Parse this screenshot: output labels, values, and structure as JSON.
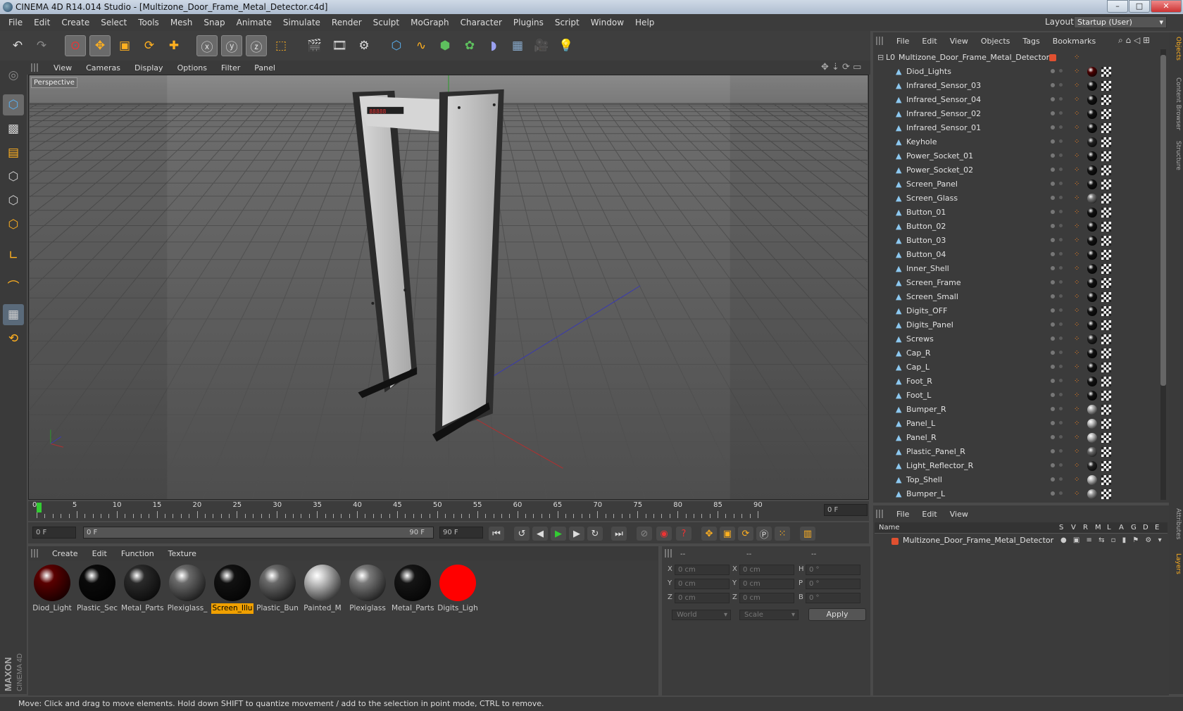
{
  "window": {
    "title": "CINEMA 4D R14.014 Studio - [Multizone_Door_Frame_Metal_Detector.c4d]",
    "minimize": "–",
    "maximize": "□",
    "close": "✕"
  },
  "menu": [
    "File",
    "Edit",
    "Create",
    "Select",
    "Tools",
    "Mesh",
    "Snap",
    "Animate",
    "Simulate",
    "Render",
    "Sculpt",
    "MoGraph",
    "Character",
    "Plugins",
    "Script",
    "Window",
    "Help"
  ],
  "layout": {
    "label": "Layout:",
    "value": "Startup (User)"
  },
  "viewport": {
    "menu": [
      "View",
      "Cameras",
      "Display",
      "Options",
      "Filter",
      "Panel"
    ],
    "label": "Perspective"
  },
  "timeline": {
    "ticks": [
      "0",
      "5",
      "10",
      "15",
      "20",
      "25",
      "30",
      "35",
      "40",
      "45",
      "50",
      "55",
      "60",
      "65",
      "70",
      "75",
      "80",
      "85",
      "90"
    ],
    "frame_field": "0 F",
    "current": "0 F",
    "slider_start": "0 F",
    "slider_end": "90 F",
    "end": "90 F"
  },
  "materials": {
    "menu": [
      "Create",
      "Edit",
      "Function",
      "Texture"
    ],
    "items": [
      {
        "label": "Diod_Light",
        "color": "#5a0000"
      },
      {
        "label": "Plastic_Sec",
        "color": "#0a0a0a"
      },
      {
        "label": "Metal_Parts",
        "color": "#2a2a2a"
      },
      {
        "label": "Plexiglass_",
        "color": "#6a6a6a"
      },
      {
        "label": "Screen_Illu",
        "color": "#111111",
        "selected": true
      },
      {
        "label": "Plastic_Bun",
        "color": "#6a6a6a"
      },
      {
        "label": "Painted_M",
        "color": "#c8c8c8"
      },
      {
        "label": "Plexiglass",
        "color": "#7a7a7a"
      },
      {
        "label": "Metal_Parts",
        "color": "#151515"
      },
      {
        "label": "Digits_Ligh",
        "color": "#ff0000"
      }
    ]
  },
  "coords": {
    "headers": [
      "--",
      "--",
      "--"
    ],
    "rows": [
      {
        "a": "X",
        "av": "0 cm",
        "b": "X",
        "bv": "0 cm",
        "c": "H",
        "cv": "0 °"
      },
      {
        "a": "Y",
        "av": "0 cm",
        "b": "Y",
        "bv": "0 cm",
        "c": "P",
        "cv": "0 °"
      },
      {
        "a": "Z",
        "av": "0 cm",
        "b": "Z",
        "bv": "0 cm",
        "c": "B",
        "cv": "0 °"
      }
    ],
    "world": "World",
    "scale": "Scale",
    "apply": "Apply"
  },
  "objects": {
    "menu": [
      "File",
      "Edit",
      "View",
      "Objects",
      "Tags",
      "Bookmarks"
    ],
    "root": "Multizone_Door_Frame_Metal_Detector",
    "items": [
      {
        "name": "Diod_Lights",
        "mat": "#4a0000"
      },
      {
        "name": "Infrared_Sensor_03",
        "mat": "#111"
      },
      {
        "name": "Infrared_Sensor_04",
        "mat": "#111"
      },
      {
        "name": "Infrared_Sensor_02",
        "mat": "#111"
      },
      {
        "name": "Infrared_Sensor_01",
        "mat": "#111"
      },
      {
        "name": "Keyhole",
        "mat": "#222"
      },
      {
        "name": "Power_Socket_01",
        "mat": "#111"
      },
      {
        "name": "Power_Socket_02",
        "mat": "#111"
      },
      {
        "name": "Screen_Panel",
        "mat": "#111"
      },
      {
        "name": "Screen_Glass",
        "mat": "#777"
      },
      {
        "name": "Button_01",
        "mat": "#111"
      },
      {
        "name": "Button_02",
        "mat": "#111"
      },
      {
        "name": "Button_03",
        "mat": "#111"
      },
      {
        "name": "Button_04",
        "mat": "#111"
      },
      {
        "name": "Inner_Shell",
        "mat": "#111"
      },
      {
        "name": "Screen_Frame",
        "mat": "#111"
      },
      {
        "name": "Screen_Small",
        "mat": "#111"
      },
      {
        "name": "Digits_OFF",
        "mat": "#111"
      },
      {
        "name": "Digits_Panel",
        "mat": "#111"
      },
      {
        "name": "Screws",
        "mat": "#222"
      },
      {
        "name": "Cap_R",
        "mat": "#111"
      },
      {
        "name": "Cap_L",
        "mat": "#111"
      },
      {
        "name": "Foot_R",
        "mat": "#111"
      },
      {
        "name": "Foot_L",
        "mat": "#111"
      },
      {
        "name": "Bumper_R",
        "mat": "#aaa"
      },
      {
        "name": "Panel_L",
        "mat": "#bbb"
      },
      {
        "name": "Panel_R",
        "mat": "#bbb"
      },
      {
        "name": "Plastic_Panel_R",
        "mat": "#666"
      },
      {
        "name": "Light_Reflector_R",
        "mat": "#222"
      },
      {
        "name": "Top_Shell",
        "mat": "#bbb"
      },
      {
        "name": "Bumper_L",
        "mat": "#999"
      }
    ]
  },
  "layers": {
    "menu": [
      "File",
      "Edit",
      "View"
    ],
    "columns": [
      "Name",
      "S",
      "V",
      "R",
      "M",
      "L",
      "A",
      "G",
      "D",
      "E"
    ],
    "row": "Multizone_Door_Frame_Metal_Detector"
  },
  "side_tabs": [
    "Objects",
    "Content Browser",
    "Structure",
    "Attributes",
    "Layers"
  ],
  "status": "Move: Click and drag to move elements. Hold down SHIFT to quantize movement / add to the selection in point mode, CTRL to remove.",
  "brand": {
    "maxon": "MAXON",
    "c4d": "CINEMA 4D"
  },
  "colors": {
    "accent": "#f0a000",
    "bg": "#4a4a4a"
  }
}
